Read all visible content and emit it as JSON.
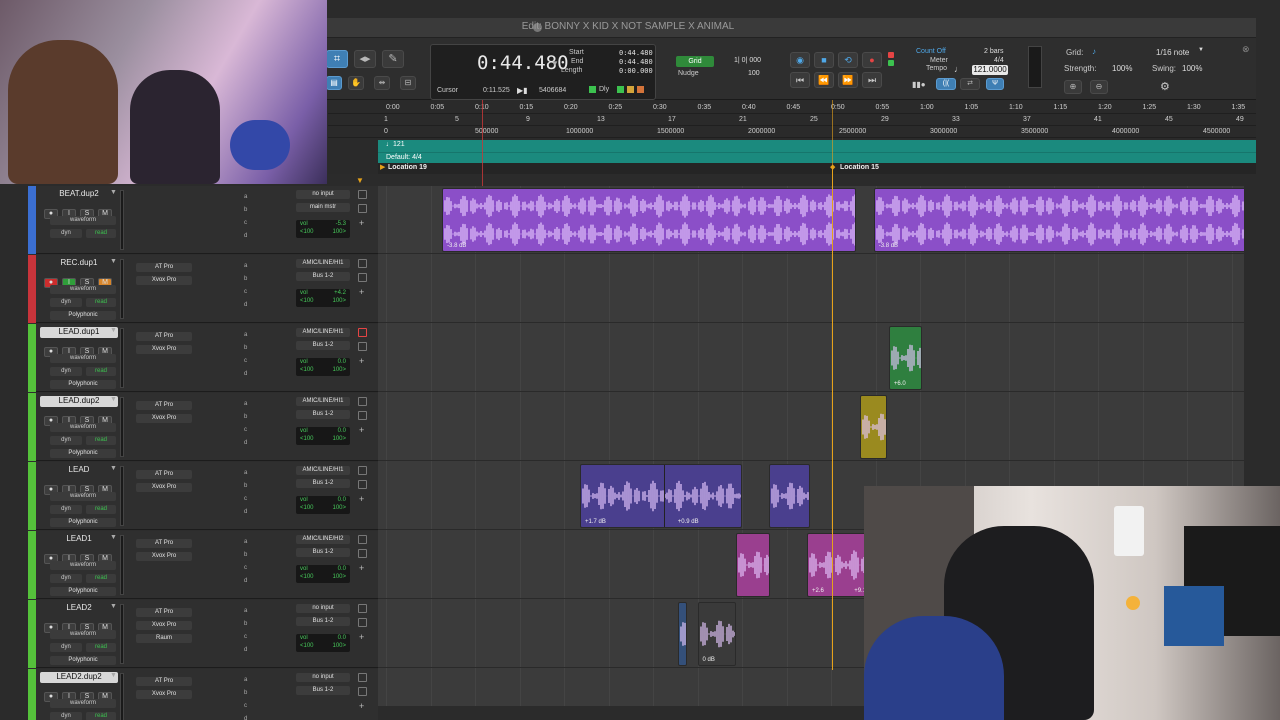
{
  "window": {
    "title": "Edit: BONNY X KID X NOT SAMPLE X ANIMAL"
  },
  "counter": {
    "main": "0:44.480",
    "start_label": "Start",
    "start_value": "0:44.480",
    "end_label": "End",
    "end_value": "0:44.480",
    "length_label": "Length",
    "length_value": "0:00.000",
    "cursor_label": "Cursor",
    "cursor_value": "0:11.525",
    "sample_value": "5406684",
    "dly_label": "Dly"
  },
  "grid": {
    "grid_label": "Grid",
    "grid_value": "1| 0| 000",
    "nudge_label": "Nudge",
    "nudge_value": "100"
  },
  "tempo": {
    "count_off": "Count Off",
    "bars": "2 bars",
    "meter_label": "Meter",
    "meter_value": "4/4",
    "tempo_label": "Tempo",
    "tempo_value": "121.0000"
  },
  "grid_cfg": {
    "grid_label": "Grid:",
    "grid_value": "1/16 note",
    "strength_label": "Strength:",
    "strength_value": "100%",
    "swing_label": "Swing:",
    "swing_value": "100%"
  },
  "rulers": {
    "min_secs": [
      "0:00",
      "0:05",
      "0:10",
      "0:15",
      "0:20",
      "0:25",
      "0:30",
      "0:35",
      "0:40",
      "0:45",
      "0:50",
      "0:55",
      "1:00",
      "1:05",
      "1:10",
      "1:15",
      "1:20",
      "1:25",
      "1:30",
      "1:35"
    ],
    "bars": [
      "1",
      "5",
      "9",
      "13",
      "17",
      "21",
      "25",
      "29",
      "33",
      "37",
      "41",
      "45",
      "49"
    ],
    "samples": [
      "0",
      "500000",
      "1000000",
      "1500000",
      "2000000",
      "2500000",
      "3000000",
      "3500000",
      "4000000",
      "4500000"
    ],
    "tempo_marker": "121",
    "meter_marker": "Default: 4/4",
    "marker_a": "Location 19",
    "marker_b": "Location 15"
  },
  "tracks": [
    {
      "name": "BEAT.dup2",
      "color": "#3b6fd2",
      "boxed": false,
      "rec": false,
      "input": false,
      "mute": false,
      "view": "waveform",
      "dyn": "dyn",
      "auto": "read",
      "extra": "",
      "inserts": [],
      "io_in": "no input",
      "io_out": "main mstr",
      "vol": "-5.3",
      "pan_l": "<100",
      "pan_r": "100>"
    },
    {
      "name": "REC.dup1",
      "color": "#c8343b",
      "boxed": false,
      "rec": true,
      "input": true,
      "mute": true,
      "view": "waveform",
      "dyn": "dyn",
      "auto": "read",
      "extra": "Polyphonic",
      "inserts": [
        "AT Pro",
        "Xvox Pro"
      ],
      "io_in": "AMIC/LINE/HI1",
      "io_out": "Bus 1-2",
      "vol": "+4.2",
      "pan_l": "<100",
      "pan_r": "100>"
    },
    {
      "name": "LEAD.dup1",
      "color": "#55c23b",
      "boxed": true,
      "rec": false,
      "input": false,
      "mute": false,
      "view": "waveform",
      "dyn": "dyn",
      "auto": "read",
      "extra": "Polyphonic",
      "inserts": [
        "AT Pro",
        "Xvox Pro"
      ],
      "io_in": "AMIC/LINE/HI1",
      "io_out": "Bus 1-2",
      "vol": "0.0",
      "pan_l": "<100",
      "pan_r": "100>"
    },
    {
      "name": "LEAD.dup2",
      "color": "#55c23b",
      "boxed": true,
      "rec": false,
      "input": false,
      "mute": false,
      "view": "waveform",
      "dyn": "dyn",
      "auto": "read",
      "extra": "Polyphonic",
      "inserts": [
        "AT Pro",
        "Xvox Pro"
      ],
      "io_in": "AMIC/LINE/HI1",
      "io_out": "Bus 1-2",
      "vol": "0.0",
      "pan_l": "<100",
      "pan_r": "100>"
    },
    {
      "name": "LEAD",
      "color": "#55c23b",
      "boxed": false,
      "rec": false,
      "input": false,
      "mute": false,
      "view": "waveform",
      "dyn": "dyn",
      "auto": "read",
      "extra": "Polyphonic",
      "inserts": [
        "AT Pro",
        "Xvox Pro"
      ],
      "io_in": "AMIC/LINE/HI1",
      "io_out": "Bus 1-2",
      "vol": "0.0",
      "pan_l": "<100",
      "pan_r": "100>"
    },
    {
      "name": "LEAD1",
      "color": "#55c23b",
      "boxed": false,
      "rec": false,
      "input": false,
      "mute": false,
      "view": "waveform",
      "dyn": "dyn",
      "auto": "read",
      "extra": "Polyphonic",
      "inserts": [
        "AT Pro",
        "Xvox Pro"
      ],
      "io_in": "AMIC/LINE/HI2",
      "io_out": "Bus 1-2",
      "vol": "0.0",
      "pan_l": "<100",
      "pan_r": "100>"
    },
    {
      "name": "LEAD2",
      "color": "#55c23b",
      "boxed": false,
      "rec": false,
      "input": false,
      "mute": false,
      "view": "waveform",
      "dyn": "dyn",
      "auto": "read",
      "extra": "Polyphonic",
      "inserts": [
        "AT Pro",
        "Xvox Pro",
        "Raum"
      ],
      "io_in": "no input",
      "io_out": "Bus 1-2",
      "vol": "0.0",
      "pan_l": "<100",
      "pan_r": "100>"
    },
    {
      "name": "LEAD2.dup2",
      "color": "#55c23b",
      "boxed": true,
      "rec": false,
      "input": false,
      "mute": false,
      "view": "waveform",
      "dyn": "dyn",
      "auto": "read",
      "extra": "",
      "inserts": [
        "AT Pro",
        "Xvox Pro"
      ],
      "io_in": "no input",
      "io_out": "Bus 1-2",
      "vol": "",
      "pan_l": "",
      "pan_r": ""
    }
  ],
  "send_letters": [
    "a",
    "b",
    "c",
    "d"
  ],
  "clips": [
    {
      "lane": 0,
      "start_sec": 6.3,
      "end_sec": 52.8,
      "color": "#8b4fc8",
      "gain": "-3.8 dB",
      "stereo": true
    },
    {
      "lane": 0,
      "start_sec": 54.8,
      "end_sec": 97.0,
      "color": "#8b4fc8",
      "gain": "-3.8 dB",
      "stereo": true
    },
    {
      "lane": 2,
      "start_sec": 56.5,
      "end_sec": 60.2,
      "color": "#2f7f3f",
      "gain": "+6.0",
      "stereo": false
    },
    {
      "lane": 3,
      "start_sec": 53.3,
      "end_sec": 56.3,
      "color": "#9a8a1f",
      "gain": "",
      "stereo": false
    },
    {
      "lane": 4,
      "start_sec": 21.8,
      "end_sec": 40.0,
      "color": "#4a3f8e",
      "gain": "+1.7 dB",
      "stereo": false,
      "split_sec": 31.1,
      "gain2": "+0.9 dB"
    },
    {
      "lane": 4,
      "start_sec": 43.0,
      "end_sec": 47.6,
      "color": "#4a3f8e",
      "gain": "",
      "stereo": false
    },
    {
      "lane": 5,
      "start_sec": 39.3,
      "end_sec": 43.2,
      "color": "#9a3f8f",
      "gain": "",
      "stereo": false
    },
    {
      "lane": 5,
      "start_sec": 47.3,
      "end_sec": 54.5,
      "color": "#9a3f8f",
      "gain": "+2.6",
      "stereo": false,
      "gain2": "+9.1"
    },
    {
      "lane": 6,
      "start_sec": 32.8,
      "end_sec": 33.8,
      "color": "#34507a",
      "gain": "",
      "stereo": false
    },
    {
      "lane": 6,
      "start_sec": 35.0,
      "end_sec": 39.3,
      "color": "#3a3a3a",
      "gain": "0 dB",
      "stereo": false
    }
  ],
  "colors": {
    "tempo_ruler": "#1b8a7e",
    "playhead": "#e6a21a",
    "selected_tool": "#3f7fb4"
  }
}
